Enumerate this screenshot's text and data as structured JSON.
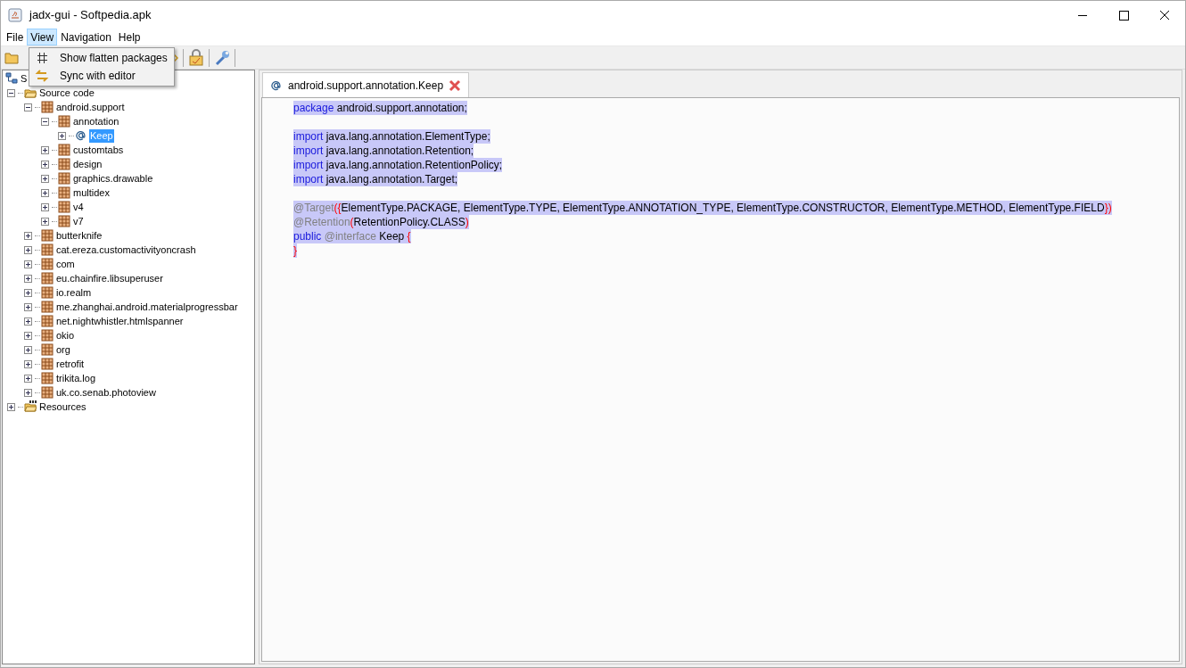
{
  "window": {
    "title": "jadx-gui - Softpedia.apk"
  },
  "menu_bar": [
    {
      "label": "File",
      "open": false
    },
    {
      "label": "View",
      "open": true
    },
    {
      "label": "Navigation",
      "open": false
    },
    {
      "label": "Help",
      "open": false
    }
  ],
  "view_menu": [
    {
      "label": "Show flatten packages",
      "kind": "grid"
    },
    {
      "label": "Sync with editor",
      "kind": "sync"
    }
  ],
  "tree": [
    {
      "label": "S",
      "kind": "root",
      "selected": false,
      "children": [
        {
          "label": "Source code",
          "kind": "folder",
          "expanded": true,
          "selected": false,
          "children": [
            {
              "label": "android.support",
              "kind": "package",
              "expanded": true,
              "selected": false,
              "children": [
                {
                  "label": "annotation",
                  "kind": "package",
                  "expanded": true,
                  "selected": false,
                  "children": [
                    {
                      "label": "Keep",
                      "kind": "annotation",
                      "expanded": false,
                      "selected": true
                    }
                  ]
                },
                {
                  "label": "customtabs",
                  "kind": "package",
                  "expanded": false,
                  "selected": false
                },
                {
                  "label": "design",
                  "kind": "package",
                  "expanded": false,
                  "selected": false
                },
                {
                  "label": "graphics.drawable",
                  "kind": "package",
                  "expanded": false,
                  "selected": false
                },
                {
                  "label": "multidex",
                  "kind": "package",
                  "expanded": false,
                  "selected": false
                },
                {
                  "label": "v4",
                  "kind": "package",
                  "expanded": false,
                  "selected": false
                },
                {
                  "label": "v7",
                  "kind": "package",
                  "expanded": false,
                  "selected": false
                }
              ]
            },
            {
              "label": "butterknife",
              "kind": "package",
              "expanded": false,
              "selected": false
            },
            {
              "label": "cat.ereza.customactivityoncrash",
              "kind": "package",
              "expanded": false,
              "selected": false
            },
            {
              "label": "com",
              "kind": "package",
              "expanded": false,
              "selected": false
            },
            {
              "label": "eu.chainfire.libsuperuser",
              "kind": "package",
              "expanded": false,
              "selected": false
            },
            {
              "label": "io.realm",
              "kind": "package",
              "expanded": false,
              "selected": false
            },
            {
              "label": "me.zhanghai.android.materialprogressbar",
              "kind": "package",
              "expanded": false,
              "selected": false
            },
            {
              "label": "net.nightwhistler.htmlspanner",
              "kind": "package",
              "expanded": false,
              "selected": false
            },
            {
              "label": "okio",
              "kind": "package",
              "expanded": false,
              "selected": false
            },
            {
              "label": "org",
              "kind": "package",
              "expanded": false,
              "selected": false
            },
            {
              "label": "retrofit",
              "kind": "package",
              "expanded": false,
              "selected": false
            },
            {
              "label": "trikita.log",
              "kind": "package",
              "expanded": false,
              "selected": false
            },
            {
              "label": "uk.co.senab.photoview",
              "kind": "package",
              "expanded": false,
              "selected": false
            }
          ]
        },
        {
          "label": "Resources",
          "kind": "resources",
          "expanded": false,
          "selected": false
        }
      ]
    }
  ],
  "tabs": [
    {
      "label": "android.support.annotation.Keep",
      "selected": true
    }
  ],
  "code": {
    "selected": true,
    "lines": [
      {
        "kind": "code",
        "tokens": [
          {
            "kind": "keyword",
            "text": "package"
          },
          {
            "kind": "plain",
            "text": " android.support.annotation;"
          }
        ]
      },
      {
        "kind": "blank"
      },
      {
        "kind": "code",
        "tokens": [
          {
            "kind": "keyword",
            "text": "import"
          },
          {
            "kind": "plain",
            "text": " java.lang.annotation.ElementType;"
          }
        ]
      },
      {
        "kind": "code",
        "tokens": [
          {
            "kind": "keyword",
            "text": "import"
          },
          {
            "kind": "plain",
            "text": " java.lang.annotation.Retention;"
          }
        ]
      },
      {
        "kind": "code",
        "tokens": [
          {
            "kind": "keyword",
            "text": "import"
          },
          {
            "kind": "plain",
            "text": " java.lang.annotation.RetentionPolicy;"
          }
        ]
      },
      {
        "kind": "code",
        "tokens": [
          {
            "kind": "keyword",
            "text": "import"
          },
          {
            "kind": "plain",
            "text": " java.lang.annotation.Target;"
          }
        ]
      },
      {
        "kind": "blank"
      },
      {
        "kind": "code",
        "tokens": [
          {
            "kind": "annotation",
            "text": "@Target"
          },
          {
            "kind": "bracket",
            "text": "({"
          },
          {
            "kind": "plain",
            "text": "ElementType.PACKAGE, ElementType.TYPE, ElementType.ANNOTATION_TYPE, ElementType.CONSTRUCTOR, ElementType.METHOD, ElementType.FIELD"
          },
          {
            "kind": "bracket",
            "text": "})"
          }
        ]
      },
      {
        "kind": "code",
        "tokens": [
          {
            "kind": "annotation",
            "text": "@Retention"
          },
          {
            "kind": "bracket",
            "text": "("
          },
          {
            "kind": "plain",
            "text": "RetentionPolicy.CLASS"
          },
          {
            "kind": "bracket",
            "text": ")"
          }
        ]
      },
      {
        "kind": "code",
        "tokens": [
          {
            "kind": "keyword",
            "text": "public"
          },
          {
            "kind": "annotation",
            "text": " @interface"
          },
          {
            "kind": "plain",
            "text": " Keep "
          },
          {
            "kind": "bracket",
            "text": "{"
          }
        ]
      },
      {
        "kind": "code",
        "tokens": [
          {
            "kind": "bracket",
            "text": "}"
          }
        ]
      }
    ]
  }
}
